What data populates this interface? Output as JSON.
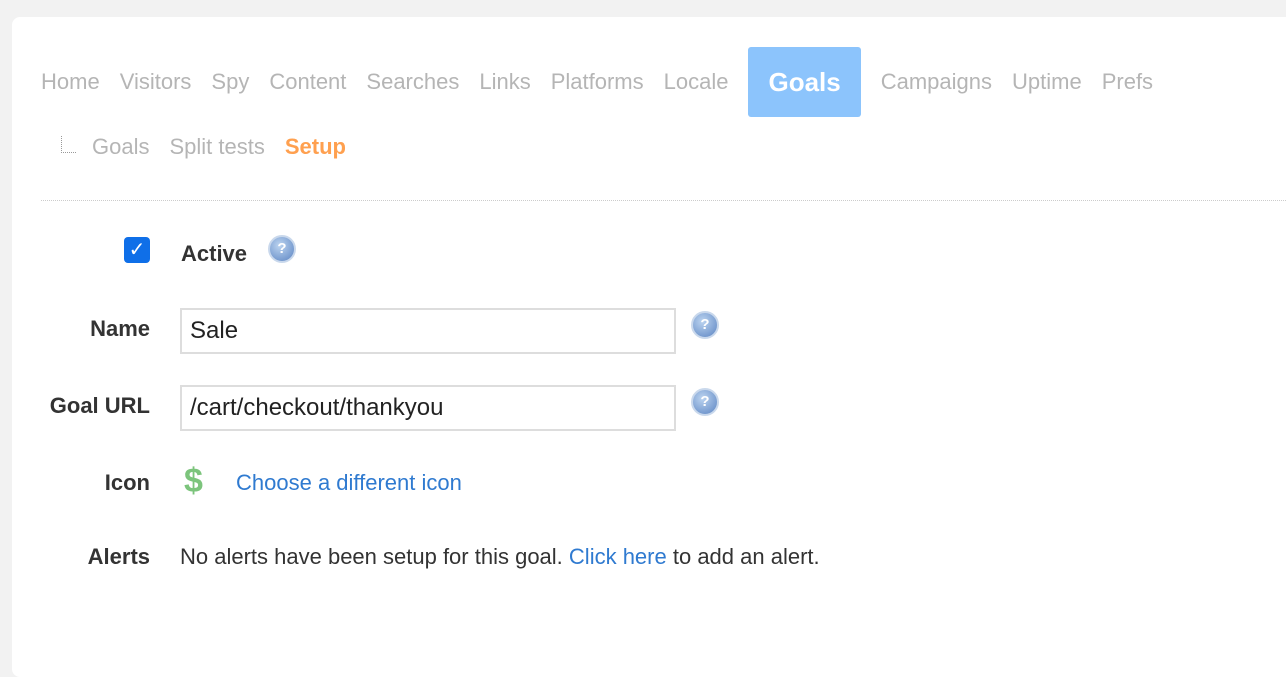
{
  "nav": {
    "items": [
      "Home",
      "Visitors",
      "Spy",
      "Content",
      "Searches",
      "Links",
      "Platforms",
      "Locale",
      "Goals",
      "Campaigns",
      "Uptime",
      "Prefs"
    ],
    "active": "Goals"
  },
  "subnav": {
    "items": [
      "Goals",
      "Split tests",
      "Setup"
    ],
    "active": "Setup"
  },
  "form": {
    "active_label": "Active",
    "active_checked": true,
    "name_label": "Name",
    "name_value": "Sale",
    "url_label": "Goal URL",
    "url_value": "/cart/checkout/thankyou",
    "icon_label": "Icon",
    "icon_glyph": "$",
    "icon_link": "Choose a different icon",
    "alerts_label": "Alerts",
    "alerts_text": "No alerts have been setup for this goal.",
    "alerts_link": "Click here",
    "alerts_suffix": "to add an alert."
  },
  "colors": {
    "active_tab": "#8cc4fc",
    "active_sub": "#ffa04f",
    "link": "#2f7ad0",
    "checkbox": "#0f6fe8"
  }
}
